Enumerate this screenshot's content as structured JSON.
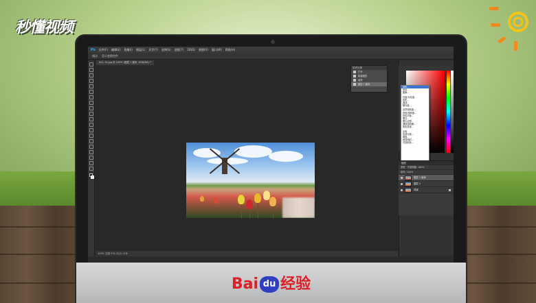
{
  "watermark": {
    "logo_text": "秒懂视频"
  },
  "brand": {
    "bai": "Bai",
    "du": "du",
    "jingyan": "经验"
  },
  "photoshop": {
    "app_icon": "Ps",
    "menu": [
      "文件(F)",
      "编辑(E)",
      "图像(I)",
      "图层(L)",
      "文字(Y)",
      "选择(S)",
      "滤镜(T)",
      "3D(D)",
      "视图(V)",
      "窗口(W)",
      "帮助(H)"
    ],
    "options_bar": {
      "mode_label": "描边",
      "sample_label": "显示变换控件"
    },
    "document_tab": "001-15.jpg @ 100% (图层 1 副本, RGB/8#) *",
    "status_bar": "100%     文档:791.2K/2.11M",
    "history": {
      "title": "历史记录",
      "items": [
        "打开",
        "新建图层",
        "填充",
        "图层 1 副本"
      ]
    },
    "adjustments_menu": {
      "items_group1": [
        "纯色...",
        "渐变...",
        "图案..."
      ],
      "items_group2": [
        "亮度/对比度...",
        "色阶...",
        "曲线...",
        "曝光度..."
      ],
      "items_group3": [
        "自然饱和度...",
        "色相/饱和度...",
        "色彩平衡...",
        "黑白...",
        "照片滤镜...",
        "通道混和器...",
        "颜色查找..."
      ],
      "items_group4": [
        "反相",
        "色调分离...",
        "阈值...",
        "渐变映射...",
        "可选颜色..."
      ]
    },
    "layers": {
      "tabs": "图层",
      "kind_label": "类型",
      "opacity_label": "不透明度: 100%",
      "fill_label": "填充: 100%",
      "rows": [
        {
          "name": "图层 1 副本",
          "selected": true
        },
        {
          "name": "图层 1",
          "selected": false
        },
        {
          "name": "背景",
          "selected": false
        }
      ]
    }
  }
}
